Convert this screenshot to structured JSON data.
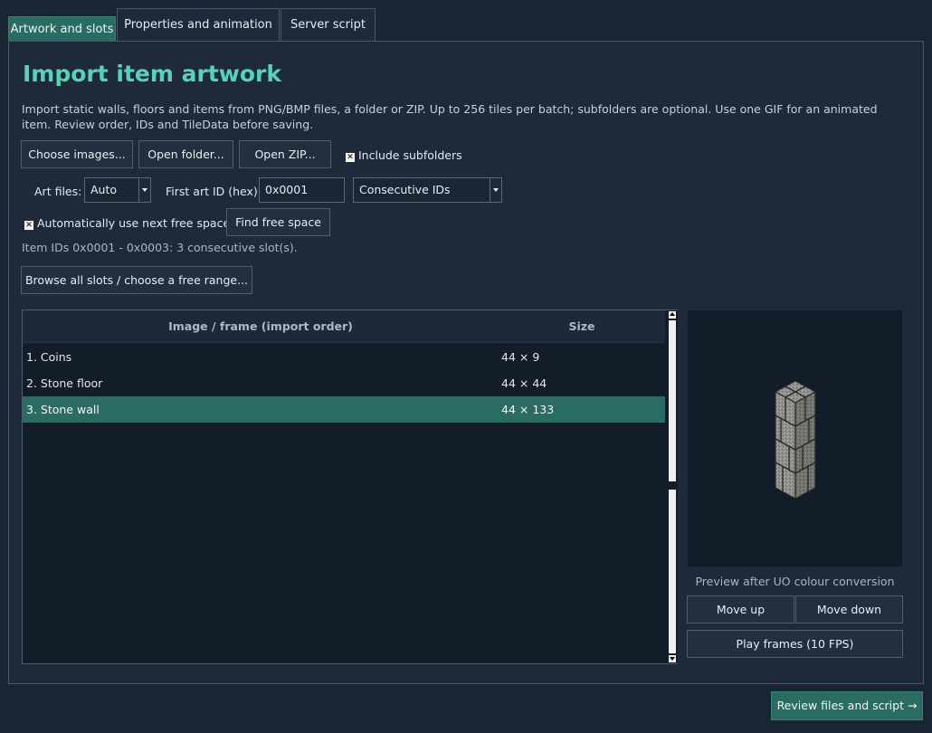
{
  "tabs": [
    {
      "label": "Artwork and slots",
      "active": true
    },
    {
      "label": "Properties and animation",
      "active": false
    },
    {
      "label": "Server script",
      "active": false
    }
  ],
  "main": {
    "title": "Import item artwork",
    "description": "Import static walls, floors and items from PNG/BMP files, a folder or ZIP. Up to 256 tiles per batch; subfolders are optional. Use one GIF for an animated item. Review order, IDs and TileData before saving.",
    "buttons": {
      "choose_images": "Choose images...",
      "open_folder": "Open folder...",
      "open_zip": "Open ZIP...",
      "find_free_space": "Find free space",
      "browse_slots": "Browse all slots / choose a free range...",
      "move_up": "Move up",
      "move_down": "Move down",
      "play_frames": "Play frames (10 FPS)"
    },
    "include_subfolders": {
      "label": "Include subfolders",
      "checked": true
    },
    "auto_free_space": {
      "label": "Automatically use next free space",
      "checked": true
    },
    "art_files": {
      "label": "Art files:",
      "value": "Auto"
    },
    "first_art_id": {
      "label": "First art ID (hex):",
      "value": "0x0001"
    },
    "id_mode": {
      "value": "Consecutive IDs"
    },
    "status": "Item IDs 0x0001 - 0x0003: 3 consecutive slot(s).",
    "table": {
      "headers": {
        "name": "Image / frame (import order)",
        "size": "Size"
      },
      "rows": [
        {
          "name": "1. Coins",
          "size": "44 × 9",
          "selected": false
        },
        {
          "name": "2. Stone floor",
          "size": "44 × 44",
          "selected": false
        },
        {
          "name": "3. Stone wall",
          "size": "44 × 133",
          "selected": true
        }
      ]
    },
    "preview_caption": "Preview after UO colour conversion"
  },
  "footer": {
    "next_label": "Review files and script →"
  },
  "colors": {
    "background": "#1a2533",
    "panel": "#1e2a39",
    "accent": "#2a6b62",
    "title": "#5ad1b4"
  }
}
